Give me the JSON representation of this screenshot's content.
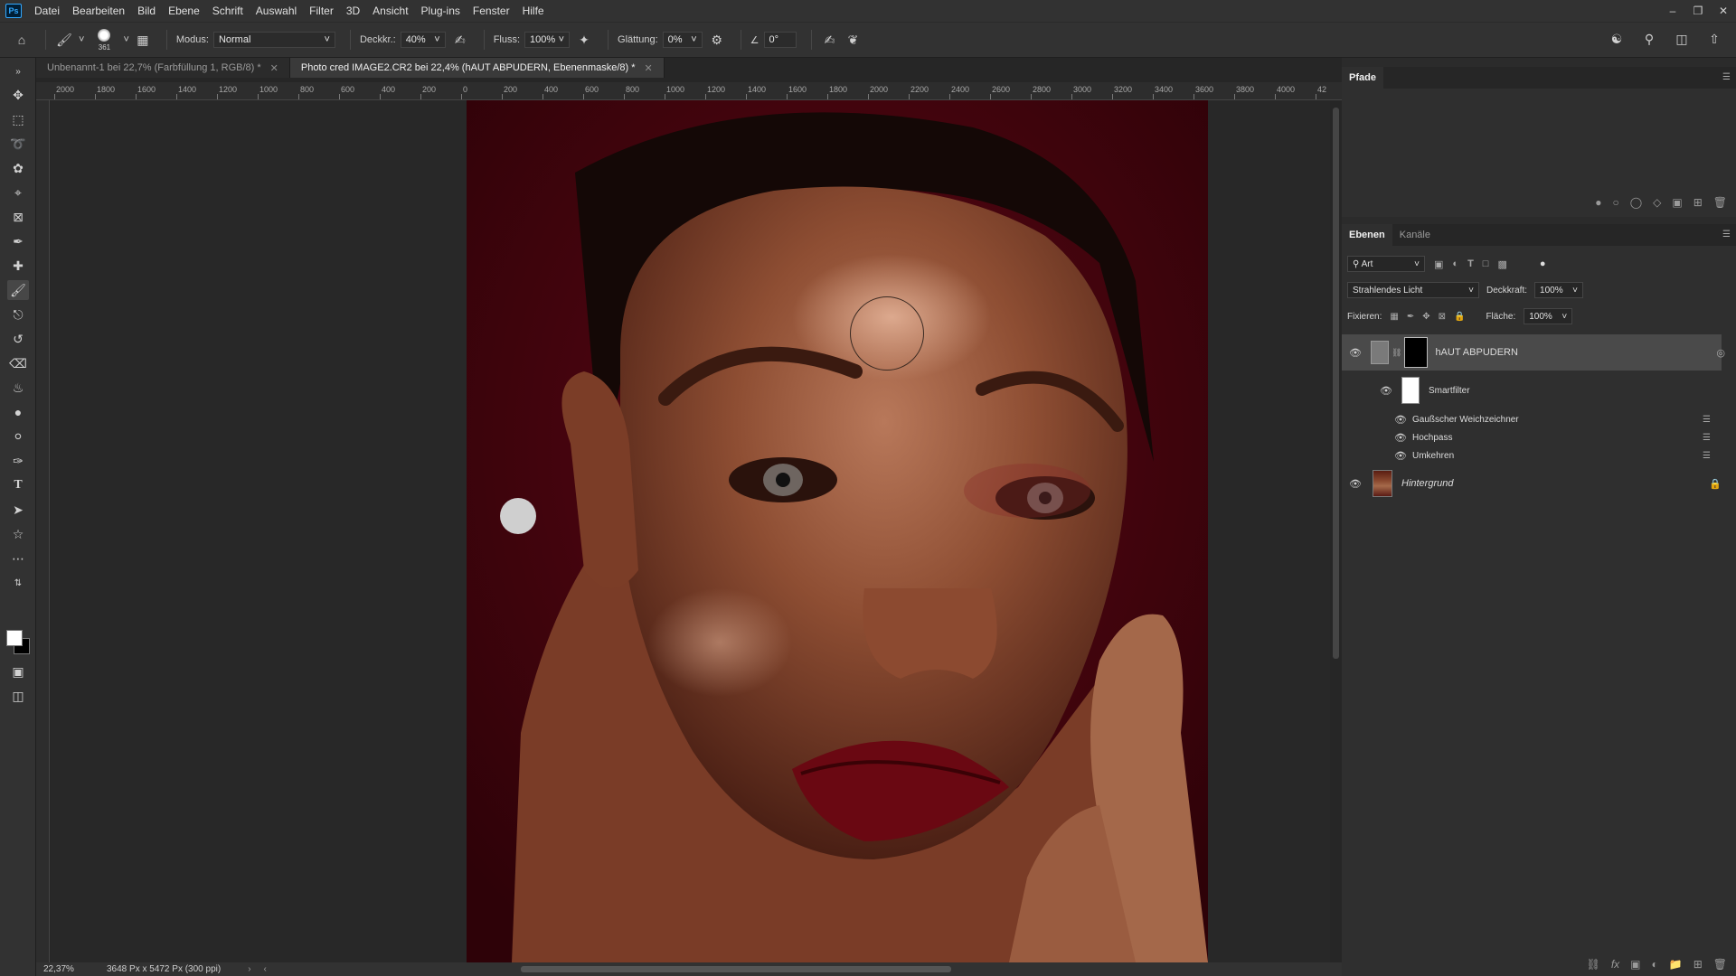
{
  "menu": [
    "Datei",
    "Bearbeiten",
    "Bild",
    "Ebene",
    "Schrift",
    "Auswahl",
    "Filter",
    "3D",
    "Ansicht",
    "Plug-ins",
    "Fenster",
    "Hilfe"
  ],
  "app_logo": "Ps",
  "options": {
    "brush_size": "361",
    "mode_label": "Modus:",
    "mode_value": "Normal",
    "opacity_label": "Deckkr.:",
    "opacity_value": "40%",
    "flow_label": "Fluss:",
    "flow_value": "100%",
    "smoothing_label": "Glättung:",
    "smoothing_value": "0%",
    "angle_value": "0°"
  },
  "tabs": [
    {
      "label": "Unbenannt-1 bei 22,7% (Farbfüllung 1, RGB/8) *"
    },
    {
      "label": "Photo cred IMAGE2.CR2 bei 22,4% (hAUT ABPUDERN, Ebenenmaske/8) *"
    }
  ],
  "ruler_h": [
    "2000",
    "1800",
    "1600",
    "1400",
    "1200",
    "1000",
    "800",
    "600",
    "400",
    "200",
    "0",
    "200",
    "400",
    "600",
    "800",
    "1000",
    "1200",
    "1400",
    "1600",
    "1800",
    "2000",
    "2200",
    "2400",
    "2600",
    "2800",
    "3000",
    "3200",
    "3400",
    "3600",
    "3800",
    "4000",
    "42"
  ],
  "status": {
    "zoom": "22,37%",
    "doc_size": "3648 Px x 5472 Px (300 ppi)"
  },
  "paths_panel": {
    "title": "Pfade"
  },
  "layers_panel": {
    "tab_layers": "Ebenen",
    "tab_channels": "Kanäle",
    "filter_kind": "Art",
    "blend_mode": "Strahlendes Licht",
    "opacity_label": "Deckkraft:",
    "opacity_value": "100%",
    "lock_label": "Fixieren:",
    "fill_label": "Fläche:",
    "fill_value": "100%",
    "layers": [
      {
        "name": "hAUT ABPUDERN"
      },
      {
        "name": "Smartfilter"
      },
      {
        "name": "Gaußscher Weichzeichner"
      },
      {
        "name": "Hochpass"
      },
      {
        "name": "Umkehren"
      },
      {
        "name": "Hintergrund"
      }
    ]
  },
  "colors": {
    "background_red": "#4a0410",
    "accent_blue": "#31a8ff",
    "skin": "#9b5a3c"
  }
}
